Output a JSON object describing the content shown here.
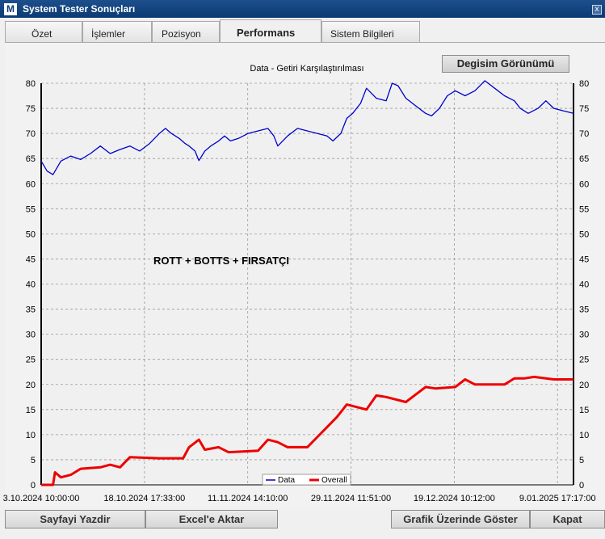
{
  "window": {
    "title": "System Tester Sonuçları",
    "logo_letter": "M",
    "close_label": "x"
  },
  "tabs": [
    {
      "label": "Özet",
      "active": false
    },
    {
      "label": "İşlemler",
      "active": false
    },
    {
      "label": "Pozisyon",
      "active": false
    },
    {
      "label": "Performans",
      "active": true
    },
    {
      "label": "Sistem Bilgileri",
      "active": false
    }
  ],
  "view_button_label": "Degisim Görünümü",
  "chart_data": {
    "type": "line",
    "title": "Data - Getiri Karşılaştırılması",
    "annotation": "ROTT + BOTTS + FIRSATÇI",
    "ylim": [
      0,
      80
    ],
    "yticks": [
      0,
      5,
      10,
      15,
      20,
      25,
      30,
      35,
      40,
      45,
      50,
      55,
      60,
      65,
      70,
      75,
      80
    ],
    "xtick_labels": [
      "3.10.2024 10:00:00",
      "18.10.2024 17:33:00",
      "11.11.2024 14:10:00",
      "29.11.2024 11:51:00",
      "19.12.2024 10:12:00",
      "9.01.2025 17:17:00"
    ],
    "grid": true,
    "legend_position": "bottom-center",
    "series": [
      {
        "name": "Data",
        "color": "#0000cc",
        "points": [
          [
            0,
            64.5
          ],
          [
            3,
            62.5
          ],
          [
            6,
            61.8
          ],
          [
            10,
            64.5
          ],
          [
            15,
            65.5
          ],
          [
            20,
            64.8
          ],
          [
            25,
            66
          ],
          [
            30,
            67.5
          ],
          [
            35,
            66
          ],
          [
            40,
            66.8
          ],
          [
            45,
            67.5
          ],
          [
            50,
            66.5
          ],
          [
            55,
            68
          ],
          [
            60,
            70
          ],
          [
            63,
            71
          ],
          [
            66,
            70
          ],
          [
            70,
            69
          ],
          [
            73,
            68
          ],
          [
            75,
            67.5
          ],
          [
            78,
            66.5
          ],
          [
            80,
            64.6
          ],
          [
            83,
            66.5
          ],
          [
            86,
            67.5
          ],
          [
            90,
            68.5
          ],
          [
            93,
            69.5
          ],
          [
            96,
            68.5
          ],
          [
            100,
            69
          ],
          [
            105,
            70
          ],
          [
            110,
            70.5
          ],
          [
            115,
            71
          ],
          [
            118,
            69.5
          ],
          [
            120,
            67.5
          ],
          [
            125,
            69.5
          ],
          [
            130,
            71
          ],
          [
            135,
            70.5
          ],
          [
            140,
            70
          ],
          [
            145,
            69.5
          ],
          [
            148,
            68.5
          ],
          [
            152,
            70
          ],
          [
            155,
            73
          ],
          [
            158,
            74
          ],
          [
            162,
            76
          ],
          [
            165,
            79
          ],
          [
            170,
            77
          ],
          [
            175,
            76.5
          ],
          [
            178,
            80
          ],
          [
            181,
            79.5
          ],
          [
            185,
            77
          ],
          [
            190,
            75.5
          ],
          [
            195,
            74
          ],
          [
            198,
            73.5
          ],
          [
            202,
            75
          ],
          [
            206,
            77.5
          ],
          [
            210,
            78.5
          ],
          [
            215,
            77.5
          ],
          [
            220,
            78.5
          ],
          [
            225,
            80.5
          ],
          [
            230,
            79
          ],
          [
            235,
            77.5
          ],
          [
            240,
            76.5
          ],
          [
            243,
            75
          ],
          [
            247,
            74
          ],
          [
            252,
            75
          ],
          [
            256,
            76.5
          ],
          [
            260,
            75
          ],
          [
            265,
            74.5
          ],
          [
            270,
            74
          ]
        ]
      },
      {
        "name": "Overall",
        "color": "#ee0000",
        "points": [
          [
            0,
            0
          ],
          [
            6,
            0
          ],
          [
            7,
            2.5
          ],
          [
            10,
            1.5
          ],
          [
            15,
            2
          ],
          [
            20,
            3.2
          ],
          [
            30,
            3.5
          ],
          [
            35,
            4
          ],
          [
            40,
            3.5
          ],
          [
            45,
            5.5
          ],
          [
            60,
            5.3
          ],
          [
            72,
            5.3
          ],
          [
            75,
            7.5
          ],
          [
            80,
            9
          ],
          [
            83,
            7
          ],
          [
            90,
            7.5
          ],
          [
            95,
            6.5
          ],
          [
            110,
            6.8
          ],
          [
            115,
            9
          ],
          [
            120,
            8.5
          ],
          [
            125,
            7.5
          ],
          [
            135,
            7.5
          ],
          [
            140,
            9.5
          ],
          [
            145,
            11.5
          ],
          [
            150,
            13.5
          ],
          [
            155,
            16
          ],
          [
            160,
            15.5
          ],
          [
            165,
            15
          ],
          [
            170,
            17.8
          ],
          [
            175,
            17.5
          ],
          [
            185,
            16.5
          ],
          [
            190,
            18
          ],
          [
            195,
            19.5
          ],
          [
            200,
            19.2
          ],
          [
            210,
            19.5
          ],
          [
            215,
            21
          ],
          [
            220,
            20
          ],
          [
            235,
            20
          ],
          [
            240,
            21.2
          ],
          [
            245,
            21.2
          ],
          [
            250,
            21.5
          ],
          [
            260,
            21
          ],
          [
            270,
            21
          ]
        ]
      }
    ]
  },
  "bottom_buttons": {
    "print": "Sayfayi Yazdir",
    "excel": "Excel'e Aktar",
    "show_chart": "Grafik Üzerinde Göster",
    "close": "Kapat"
  }
}
